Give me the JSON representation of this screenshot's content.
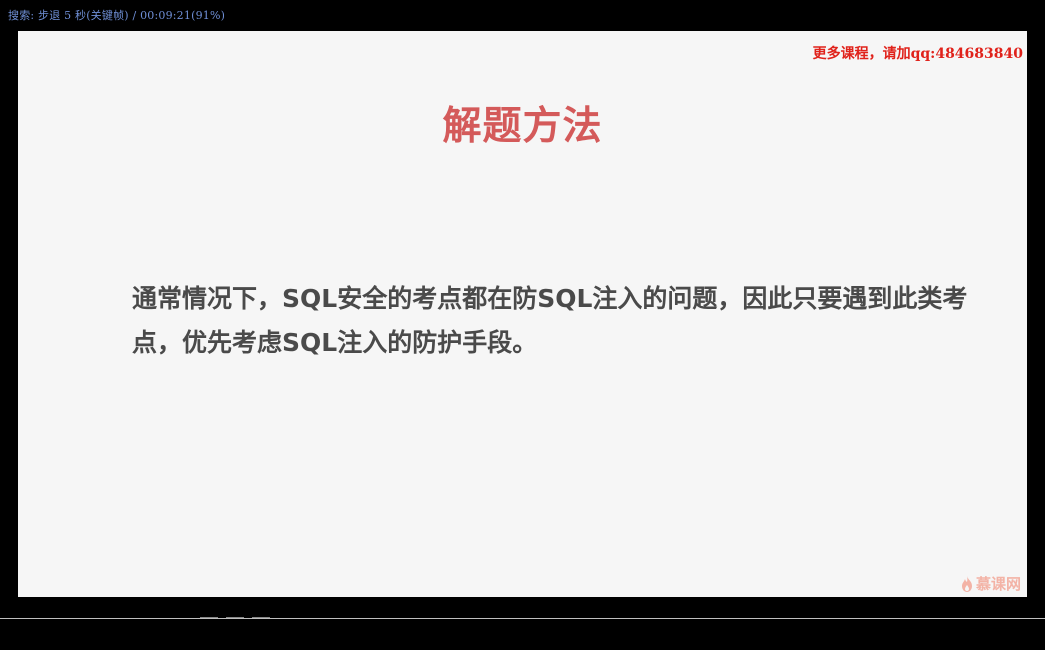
{
  "osd": {
    "status_text": "搜索: 步退 5 秒(关键帧) / 00:09:21(91%)",
    "progress": 0.91
  },
  "overlay": {
    "promo_text": "更多课程，请加qq:484683840"
  },
  "slide": {
    "title": "解题方法",
    "body": "通常情况下，SQL安全的考点都在防SQL注入的问题，因此只要遇到此类考点，优先考虑SQL注入的防护手段。"
  },
  "watermark": {
    "text": "慕课网",
    "icon": "flame-icon"
  },
  "colors": {
    "title": "#d45a5a",
    "promo": "#e0221b",
    "osd": "#6f8fd6",
    "watermark": "#f3b3a6"
  }
}
